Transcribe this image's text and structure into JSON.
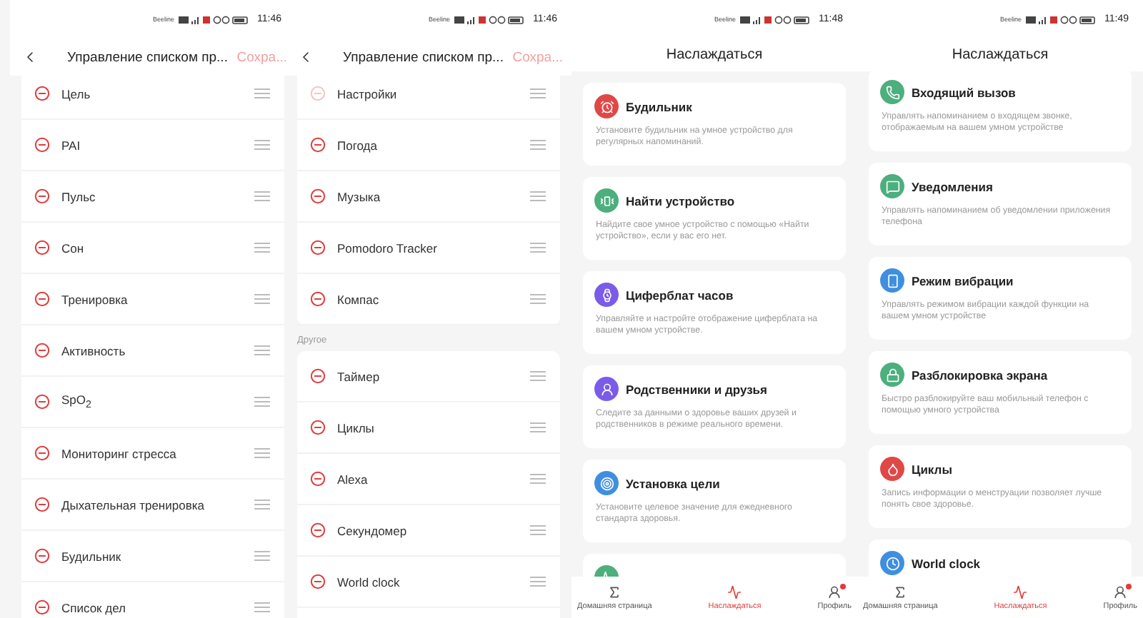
{
  "screens": [
    {
      "kind": "edit_list",
      "status_bar": {
        "carrier": "Beeline",
        "time": "11:46"
      },
      "header": {
        "title": "Управление списком пр...",
        "action": "Сохра..."
      },
      "sections": [
        {
          "items": [
            {
              "label": "Цель",
              "disabled": false
            },
            {
              "label": "PAI",
              "disabled": false
            },
            {
              "label": "Пульс",
              "disabled": false
            },
            {
              "label": "Сон",
              "disabled": false
            },
            {
              "label": "Тренировка",
              "disabled": false
            },
            {
              "label": "Активность",
              "disabled": false
            },
            {
              "label": "SpO$_{2}$",
              "disabled": false
            },
            {
              "label": "Мониторинг стресса",
              "disabled": false
            },
            {
              "label": "Дыхательная тренировка",
              "disabled": false
            },
            {
              "label": "Будильник",
              "disabled": false
            },
            {
              "label": "Список дел",
              "disabled": false
            }
          ]
        }
      ]
    },
    {
      "kind": "edit_list",
      "status_bar": {
        "carrier": "Beeline",
        "time": "11:46"
      },
      "header": {
        "title": "Управление списком пр...",
        "action": "Сохра..."
      },
      "sections": [
        {
          "items": [
            {
              "label": "Настройки",
              "disabled": true
            },
            {
              "label": "Погода",
              "disabled": false
            },
            {
              "label": "Музыка",
              "disabled": false
            },
            {
              "label": "Pomodoro Tracker",
              "disabled": false
            },
            {
              "label": "Компас",
              "disabled": false
            }
          ]
        },
        {
          "heading": "Другое",
          "items": [
            {
              "label": "Таймер",
              "disabled": false
            },
            {
              "label": "Циклы",
              "disabled": false
            },
            {
              "label": "Alexa",
              "disabled": false
            },
            {
              "label": "Секундомер",
              "disabled": false
            },
            {
              "label": "World clock",
              "disabled": false
            }
          ]
        }
      ]
    },
    {
      "kind": "feature_cards",
      "status_bar": {
        "carrier": "Beeline",
        "time": "11:48"
      },
      "header": {
        "title": "Наслаждаться"
      },
      "cards": [
        {
          "title": "Будильник",
          "description": "Установите будильник на умное устройство для регулярных напоминаний.",
          "color": "#e04848"
        },
        {
          "title": "Найти устройство",
          "description": "Найдите свое умное устройство с помощью «Найти устройство», если у вас его нет.",
          "color": "#4caf7d"
        },
        {
          "title": "Циферблат часов",
          "description": "Управляйте и настройте отображение циферблата на вашем умном устройстве.",
          "color": "#7b5ce8"
        },
        {
          "title": "Родственники и друзья",
          "description": "Следите за данными о здоровье ваших друзей и родственников в режиме реального времени.",
          "color": "#7b5ce8"
        },
        {
          "title": "Установка цели",
          "description": "Установите целевое значение для ежедневного стандарта здоровья.",
          "color": "#3f8fe0"
        },
        {
          "color": "#4caf7d"
        }
      ],
      "tabs": [
        {
          "label": "Домашняя страница",
          "selected": false,
          "dot": false
        },
        {
          "label": "Наслаждаться",
          "selected": true,
          "dot": false
        },
        {
          "label": "Профиль",
          "selected": false,
          "dot": true
        }
      ]
    },
    {
      "kind": "feature_cards",
      "status_bar": {
        "carrier": "Beeline",
        "time": "11:49"
      },
      "header": {
        "title": "Наслаждаться"
      },
      "cards": [
        {
          "title": "Входящий вызов",
          "description": "Управлять напоминанием о входящем звонке, отображаемым на вашем умном устройстве",
          "color": "#4caf7d"
        },
        {
          "title": "Уведомления",
          "description": "Управлять напоминанием об уведомлении приложения телефона",
          "color": "#4caf7d"
        },
        {
          "title": "Режим вибрации",
          "description": "Управлять режимом вибрации каждой функции на вашем умном устройстве",
          "color": "#3f8fe0"
        },
        {
          "title": "Разблокировка экрана",
          "description": "Быстро разблокируйте ваш мобильный телефон с помощью умного устройства",
          "color": "#4caf7d"
        },
        {
          "title": "Циклы",
          "description": "Запись информации о менструации позволяет лучше понять свое здоровье.",
          "color": "#e04848"
        },
        {
          "title": "World clock",
          "color": "#3f8fe0"
        }
      ],
      "tabs": [
        {
          "label": "Домашняя страница",
          "selected": false,
          "dot": false
        },
        {
          "label": "Наслаждаться",
          "selected": true,
          "dot": false
        },
        {
          "label": "Профиль",
          "selected": false,
          "dot": true
        }
      ]
    }
  ]
}
